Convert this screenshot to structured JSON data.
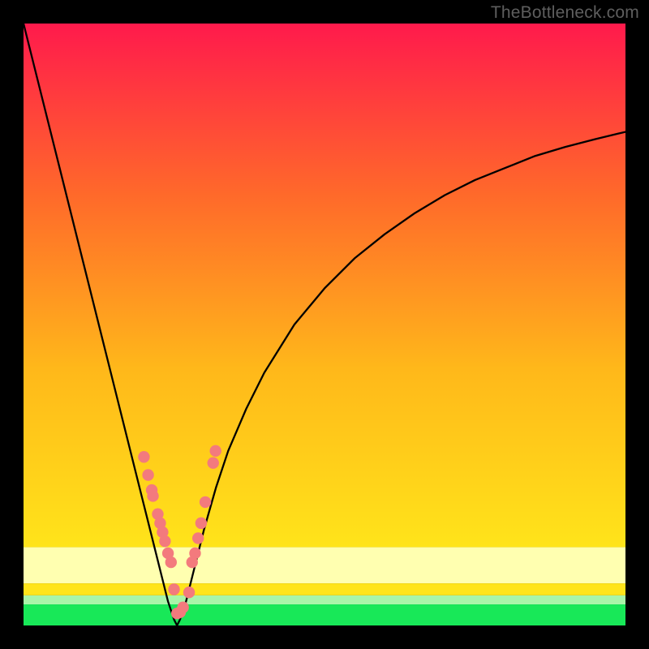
{
  "watermark": "TheBottleneck.com",
  "colors": {
    "topGradient": "#ff1a4c",
    "midGradient1": "#ff6a2a",
    "midGradient2": "#ffb81a",
    "midGradient3": "#ffe41a",
    "paleYellow": "#ffffb0",
    "paleGreen": "#a8f5a8",
    "green": "#18e858",
    "curve": "#000000",
    "marker": "#f37a7d",
    "frame": "#000000"
  },
  "chart_data": {
    "type": "line",
    "title": "",
    "xlabel": "",
    "ylabel": "",
    "x_range": [
      0,
      100
    ],
    "y_range": [
      0,
      100
    ],
    "curve_minimum_x": 25.5,
    "left_branch": {
      "x": [
        0,
        2,
        4,
        6,
        8,
        10,
        12,
        14,
        16,
        18,
        20,
        21,
        22,
        23,
        24,
        25,
        25.5
      ],
      "y": [
        100,
        92,
        84,
        76,
        68,
        60,
        52,
        44,
        36,
        28,
        20,
        16,
        12,
        8,
        4,
        1,
        0
      ]
    },
    "right_branch": {
      "x": [
        25.5,
        26,
        27,
        28,
        29,
        30,
        32,
        34,
        37,
        40,
        45,
        50,
        55,
        60,
        65,
        70,
        75,
        80,
        85,
        90,
        95,
        100
      ],
      "y": [
        0,
        1,
        4,
        8,
        12,
        16,
        23,
        29,
        36,
        42,
        50,
        56,
        61,
        65,
        68.5,
        71.5,
        74,
        76,
        78,
        79.5,
        80.8,
        82
      ]
    },
    "series": [
      {
        "name": "bottleneck-curve",
        "x": [
          0,
          2,
          4,
          6,
          8,
          10,
          12,
          14,
          16,
          18,
          20,
          21,
          22,
          23,
          24,
          25,
          25.5,
          26,
          27,
          28,
          29,
          30,
          32,
          34,
          37,
          40,
          45,
          50,
          55,
          60,
          65,
          70,
          75,
          80,
          85,
          90,
          95,
          100
        ],
        "y": [
          100,
          92,
          84,
          76,
          68,
          60,
          52,
          44,
          36,
          28,
          20,
          16,
          12,
          8,
          4,
          1,
          0,
          1,
          4,
          8,
          12,
          16,
          23,
          29,
          36,
          42,
          50,
          56,
          61,
          65,
          68.5,
          71.5,
          74,
          76,
          78,
          79.5,
          80.8,
          82
        ]
      }
    ],
    "markers": {
      "name": "sample-points",
      "x": [
        20.0,
        20.7,
        21.3,
        21.5,
        22.3,
        22.7,
        23.1,
        23.5,
        24.0,
        24.5,
        25.0,
        25.5,
        26.0,
        26.5,
        27.5,
        28.0,
        28.5,
        29.0,
        29.5,
        30.2,
        31.5,
        31.9
      ],
      "y": [
        28.0,
        25.0,
        22.5,
        21.5,
        18.5,
        17.0,
        15.5,
        14.0,
        12.0,
        10.5,
        6.0,
        2.0,
        2.2,
        3.0,
        5.5,
        10.5,
        12.0,
        14.5,
        17.0,
        20.5,
        27.0,
        29.0
      ]
    },
    "gradient_bands": [
      {
        "y_start": 100,
        "y_end": 13,
        "type": "smooth",
        "from": "#ff1a4c",
        "to": "#ffe41a"
      },
      {
        "y_start": 13,
        "y_end": 7,
        "type": "solid",
        "color": "#ffffb0"
      },
      {
        "y_start": 7,
        "y_end": 5,
        "type": "solid",
        "color": "#ffe41a"
      },
      {
        "y_start": 5,
        "y_end": 3.5,
        "type": "solid",
        "color": "#a8f5a8"
      },
      {
        "y_start": 3.5,
        "y_end": 0,
        "type": "solid",
        "color": "#18e858"
      }
    ]
  }
}
